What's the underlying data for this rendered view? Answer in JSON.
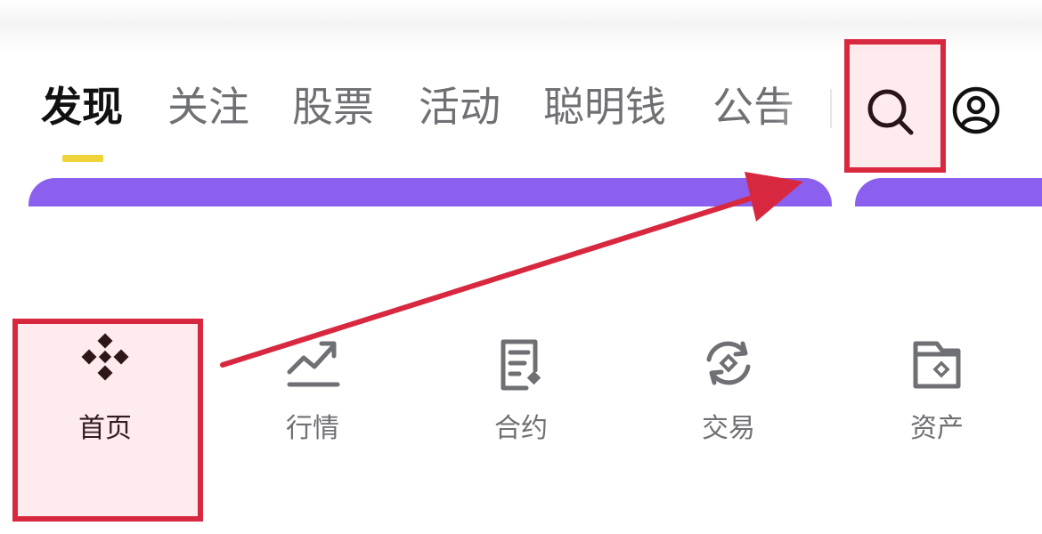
{
  "header": {
    "tabs": [
      {
        "label": "发现",
        "active": true
      },
      {
        "label": "关注",
        "active": false
      },
      {
        "label": "股票",
        "active": false
      },
      {
        "label": "活动",
        "active": false
      },
      {
        "label": "聪明钱",
        "active": false
      },
      {
        "label": "公告",
        "active": false
      }
    ],
    "search_icon": "search-icon",
    "profile_icon": "user-circle-icon"
  },
  "bottom_nav": {
    "items": [
      {
        "label": "首页",
        "icon": "binance-logo-icon",
        "active": true
      },
      {
        "label": "行情",
        "icon": "chart-trend-icon",
        "active": false
      },
      {
        "label": "合约",
        "icon": "document-icon",
        "active": false
      },
      {
        "label": "交易",
        "icon": "exchange-icon",
        "active": false
      },
      {
        "label": "资产",
        "icon": "wallet-icon",
        "active": false
      }
    ]
  },
  "colors": {
    "accent_underline": "#f0d33a",
    "banner": "#8b60ee",
    "annotation_red": "#d8283f",
    "text_active": "#111111",
    "text_inactive": "#6f7074"
  }
}
